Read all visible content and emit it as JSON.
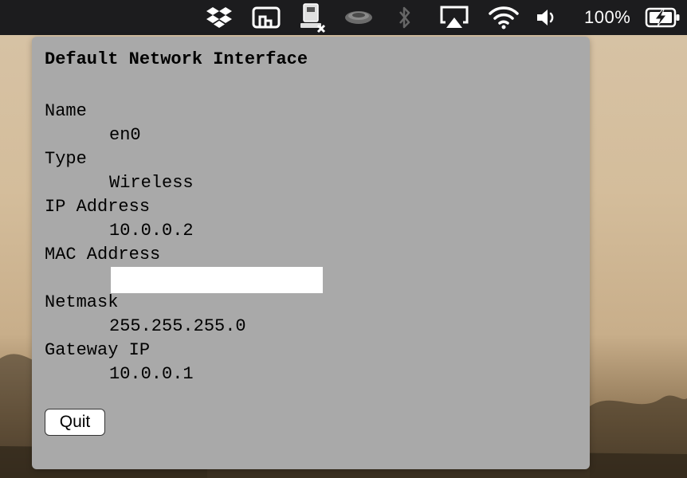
{
  "menubar": {
    "icons": [
      "dropbox-icon",
      "cloud-sync-icon",
      "network-monitor-icon",
      "teacup-icon",
      "bluetooth-icon",
      "airplay-icon",
      "wifi-icon",
      "volume-icon",
      "battery-charging-icon"
    ],
    "battery_percent": "100%"
  },
  "panel": {
    "title": "Default Network Interface",
    "fields": [
      {
        "label": "Name",
        "value": "en0"
      },
      {
        "label": "Type",
        "value": "Wireless"
      },
      {
        "label": "IP Address",
        "value": "10.0.0.2"
      },
      {
        "label": "MAC Address",
        "value": ""
      },
      {
        "label": "Netmask",
        "value": "255.255.255.0"
      },
      {
        "label": "Gateway IP",
        "value": "10.0.0.1"
      }
    ],
    "quit_label": "Quit"
  }
}
